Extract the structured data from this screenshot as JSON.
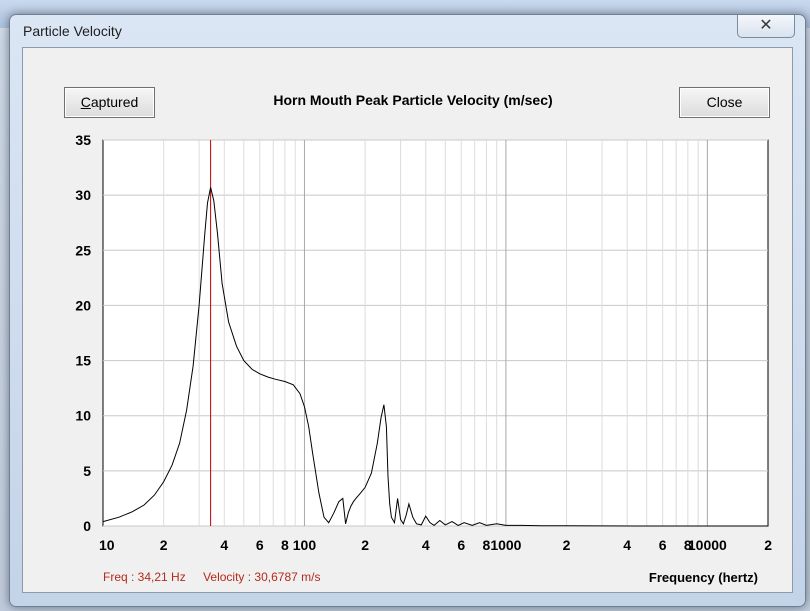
{
  "window": {
    "title": "Particle Velocity",
    "close_glyph": "✕"
  },
  "toolbar": {
    "captured_label": "Captured",
    "captured_underline": "C",
    "close_label": "Close"
  },
  "heading": "Horn Mouth Peak Particle Velocity (m/sec)",
  "readout": {
    "freq": "Freq : 34,21 Hz",
    "velocity": "Velocity : 30,6787 m/s"
  },
  "colors": {
    "curve": "#000000",
    "cursor": "#c00000",
    "grid": "#c8c8c8",
    "readout": "#b52a1c"
  },
  "chart_data": {
    "type": "line",
    "title": "Horn Mouth Peak Particle Velocity (m/sec)",
    "xlabel": "Frequency (hertz)",
    "ylabel": "",
    "x_scale": "log",
    "xlim": [
      10,
      20000
    ],
    "ylim": [
      0,
      35
    ],
    "grid": true,
    "y_ticks": [
      "35",
      "30",
      "25",
      "20",
      "15",
      "10",
      "5",
      "0"
    ],
    "x_tick_labels": [
      {
        "value": 10,
        "label": "10"
      },
      {
        "value": 20,
        "label": "2"
      },
      {
        "value": 40,
        "label": "4"
      },
      {
        "value": 60,
        "label": "6"
      },
      {
        "value": 80,
        "label": "8"
      },
      {
        "value": 100,
        "label": "100"
      },
      {
        "value": 200,
        "label": "2"
      },
      {
        "value": 400,
        "label": "4"
      },
      {
        "value": 600,
        "label": "6"
      },
      {
        "value": 800,
        "label": "8"
      },
      {
        "value": 1000,
        "label": "1000"
      },
      {
        "value": 2000,
        "label": "2"
      },
      {
        "value": 4000,
        "label": "4"
      },
      {
        "value": 6000,
        "label": "6"
      },
      {
        "value": 8000,
        "label": "8"
      },
      {
        "value": 10000,
        "label": "10000"
      },
      {
        "value": 20000,
        "label": "2"
      }
    ],
    "cursor_x": 34.21,
    "series": [
      {
        "x": [
          10,
          12,
          14,
          16,
          18,
          20,
          22,
          24,
          26,
          28,
          30,
          32,
          33,
          34.2,
          35.5,
          37,
          39,
          42,
          46,
          50,
          55,
          60,
          66,
          72,
          80,
          88,
          95,
          100,
          105,
          110,
          118,
          125,
          132,
          140,
          148,
          155,
          160,
          165,
          170,
          175,
          180,
          190,
          200,
          215,
          230,
          240,
          248,
          255,
          260,
          265,
          270,
          280,
          290,
          300,
          310,
          320,
          330,
          345,
          360,
          380,
          400,
          420,
          440,
          470,
          500,
          540,
          580,
          620,
          680,
          740,
          800,
          900,
          1000,
          1200,
          1500,
          2000,
          3000,
          5000,
          10000,
          20000
        ],
        "y": [
          0.4,
          0.8,
          1.3,
          1.9,
          2.8,
          4.0,
          5.5,
          7.5,
          10.5,
          14.5,
          20.0,
          26.5,
          29.3,
          30.7,
          29.5,
          26.5,
          22.0,
          18.5,
          16.3,
          15.0,
          14.2,
          13.8,
          13.5,
          13.3,
          13.1,
          12.8,
          12.0,
          10.8,
          9.0,
          6.5,
          3.0,
          0.8,
          0.3,
          1.2,
          2.2,
          2.5,
          0.2,
          1.2,
          1.8,
          2.2,
          2.5,
          3.0,
          3.5,
          4.8,
          7.5,
          9.8,
          11.0,
          9.0,
          4.5,
          2.0,
          0.8,
          0.3,
          2.5,
          0.6,
          0.2,
          1.0,
          2.0,
          0.8,
          0.2,
          0.1,
          0.9,
          0.3,
          0.05,
          0.5,
          0.1,
          0.4,
          0.05,
          0.3,
          0.05,
          0.3,
          0.05,
          0.2,
          0.05,
          0.05,
          0.03,
          0.02,
          0.01,
          0.0,
          0.0,
          0.0
        ]
      }
    ]
  }
}
